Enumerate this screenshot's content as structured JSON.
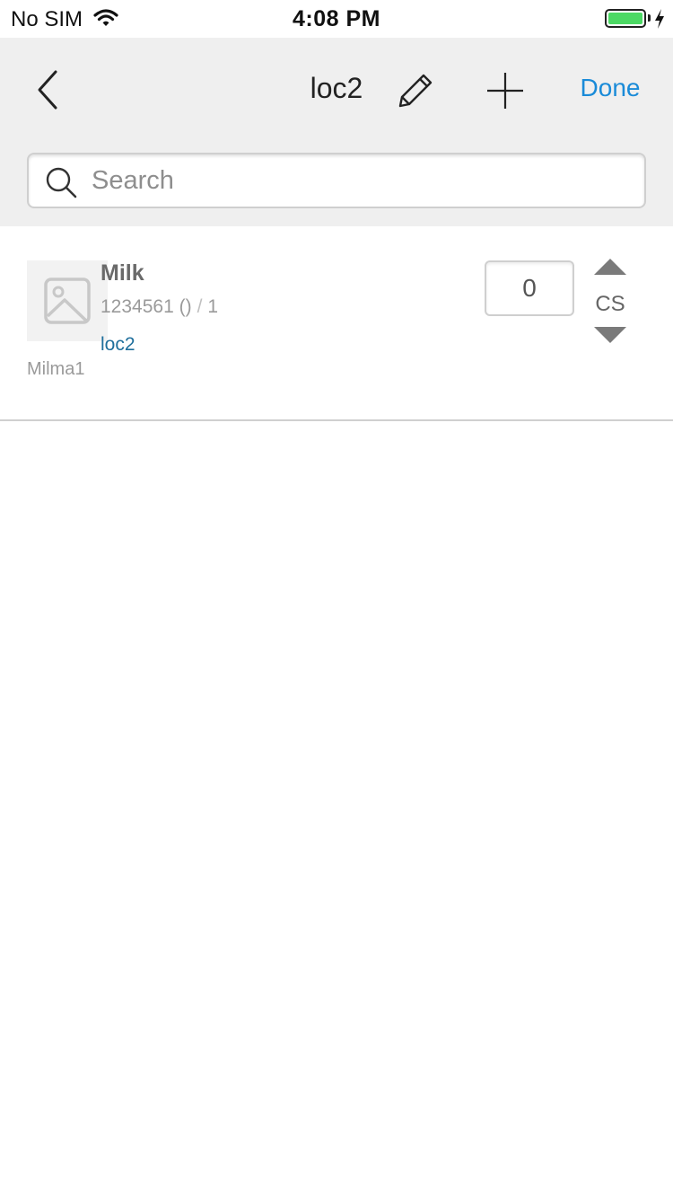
{
  "status_bar": {
    "carrier": "No SIM",
    "time": "4:08 PM",
    "battery_level": 1.0,
    "battery_color": "#4cd964"
  },
  "nav": {
    "back_icon": "chevron-left-icon",
    "title": "loc2",
    "edit_icon": "pencil-icon",
    "add_icon": "plus-icon",
    "done_label": "Done",
    "accent_color": "#1a8bd8"
  },
  "search": {
    "placeholder": "Search",
    "value": "",
    "icon": "search-icon"
  },
  "items": [
    {
      "image_icon": "image-placeholder-icon",
      "name": "Milk",
      "code": "1234561 ()",
      "separator": "/",
      "pack": "1",
      "location": "loc2",
      "brand": "Milma1",
      "quantity": "0",
      "unit": "CS",
      "up_icon": "triangle-up-icon",
      "down_icon": "triangle-down-icon"
    }
  ]
}
